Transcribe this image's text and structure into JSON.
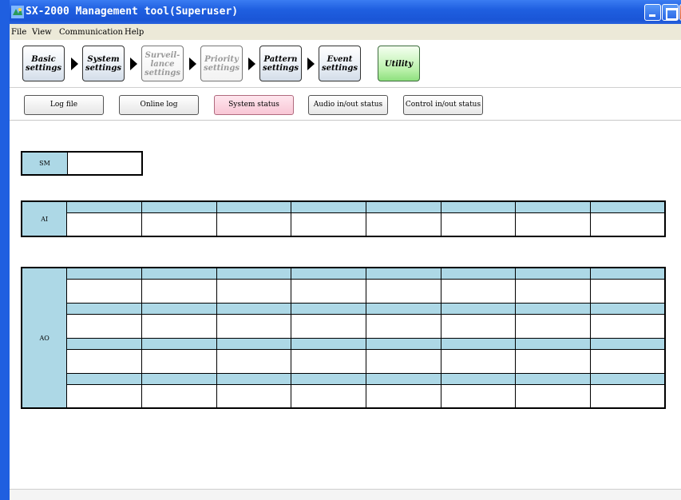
{
  "window": {
    "title": "SX-2000 Management tool(Superuser)",
    "app_icon": "app-icon"
  },
  "menu": [
    {
      "label": "File"
    },
    {
      "label": "View"
    },
    {
      "label": "Communication"
    },
    {
      "label": "Help"
    }
  ],
  "wizard": {
    "steps": [
      {
        "line1": "Basic",
        "line2": "settings",
        "line3": ""
      },
      {
        "line1": "System",
        "line2": "settings",
        "line3": ""
      },
      {
        "line1": "Surveil-",
        "line2": "lance",
        "line3": "settings"
      },
      {
        "line1": "Priority",
        "line2": "settings",
        "line3": ""
      },
      {
        "line1": "Pattern",
        "line2": "settings",
        "line3": ""
      },
      {
        "line1": "Event",
        "line2": "settings",
        "line3": ""
      },
      {
        "line1": "Utility",
        "line2": "",
        "line3": ""
      }
    ]
  },
  "subtabs": [
    {
      "label": "Log file"
    },
    {
      "label": "Online log"
    },
    {
      "label": "System status"
    },
    {
      "label": "Audio in/out status"
    },
    {
      "label": "Control in/out status"
    }
  ],
  "status": {
    "sm_label": "SM",
    "ai_label": "AI",
    "ao_label": "AO"
  },
  "colors": {
    "header_fill": "#add8e6",
    "active_tab": "#f8c6d5",
    "utility_button": "#b8f0a8"
  }
}
